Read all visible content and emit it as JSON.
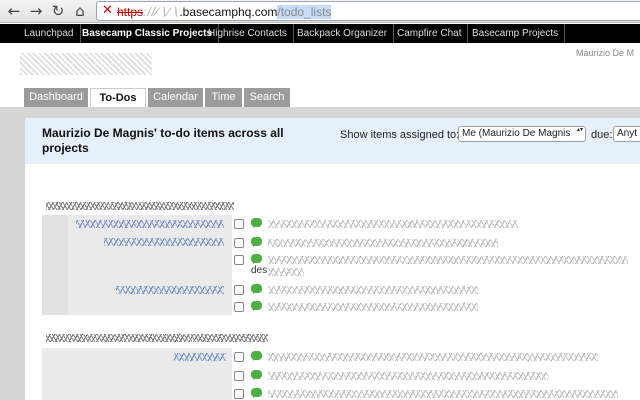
{
  "browser": {
    "url_scheme": "https",
    "url_host": ".basecamphq.com",
    "url_path": "/todo_lists",
    "back_icon": "arrow-left",
    "forward_icon": "arrow-right",
    "reload_icon": "reload",
    "home_icon": "home"
  },
  "appbar": {
    "links": [
      "Launchpad",
      "Basecamp Classic Projects",
      "Highrise Contacts",
      "Backpack Organizer",
      "Campfire Chat",
      "Basecamp Projects"
    ]
  },
  "header": {
    "user_name": "Maurizio De M"
  },
  "tabs": [
    "Dashboard",
    "To-Dos",
    "Calendar",
    "Time",
    "Search"
  ],
  "page": {
    "title": "Maurizio De Magnis' to-do items across all projects",
    "filter_label": "Show items assigned to:",
    "assignee_value": "Me (Maurizio De Magnis",
    "due_label": "due:",
    "due_value": "Anyt",
    "wrap_fragment": "des"
  },
  "colors": {
    "appbar": "#000000",
    "tab": "#9b9b9b",
    "header_band": "#e5f0fa",
    "comment_icon": "#4db043"
  }
}
